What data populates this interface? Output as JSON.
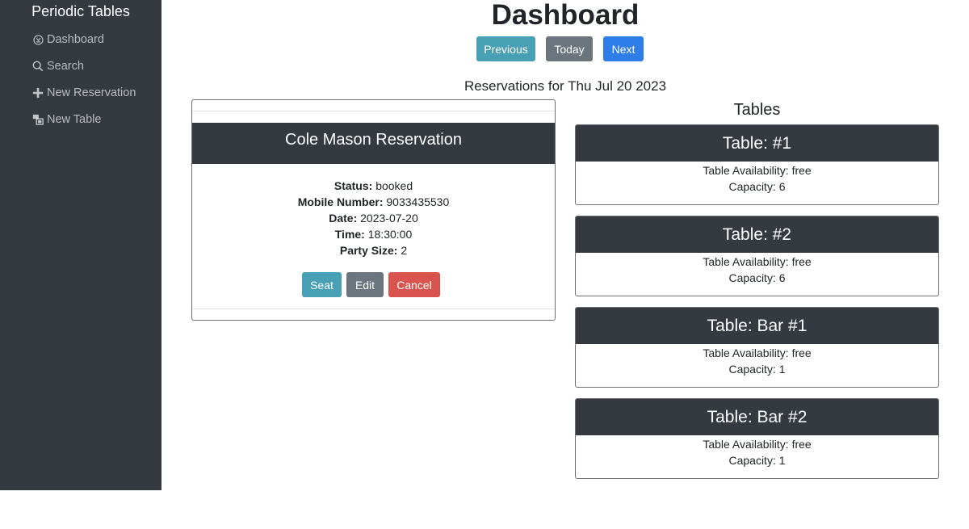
{
  "sidebar": {
    "brand": "Periodic Tables",
    "items": [
      {
        "label": "Dashboard",
        "icon": "dashboard-icon"
      },
      {
        "label": "Search",
        "icon": "search-icon"
      },
      {
        "label": "New Reservation",
        "icon": "plus-icon"
      },
      {
        "label": "New Table",
        "icon": "table-icon"
      }
    ]
  },
  "header": {
    "title": "Dashboard",
    "buttons": {
      "previous": "Previous",
      "today": "Today",
      "next": "Next"
    }
  },
  "reservations": {
    "heading": "Reservations for Thu Jul 20 2023",
    "items": [
      {
        "title": "Cole Mason Reservation",
        "status_label": "Status:",
        "status": "booked",
        "mobile_label": "Mobile Number:",
        "mobile": "9033435530",
        "date_label": "Date:",
        "date": "2023-07-20",
        "time_label": "Time:",
        "time": "18:30:00",
        "party_label": "Party Size:",
        "party_size": "2",
        "actions": {
          "seat": "Seat",
          "edit": "Edit",
          "cancel": "Cancel"
        }
      }
    ]
  },
  "tables": {
    "heading": "Tables",
    "items": [
      {
        "name": "Table: #1",
        "availability": "Table Availability: free",
        "capacity": "Capacity: 6"
      },
      {
        "name": "Table: #2",
        "availability": "Table Availability: free",
        "capacity": "Capacity: 6"
      },
      {
        "name": "Table: Bar #1",
        "availability": "Table Availability: free",
        "capacity": "Capacity: 1"
      },
      {
        "name": "Table: Bar #2",
        "availability": "Table Availability: free",
        "capacity": "Capacity: 1"
      }
    ]
  },
  "colors": {
    "sidebar_bg": "#343a40",
    "info": "#48a0b4",
    "secondary": "#6c757d",
    "primary": "#2f7de8",
    "danger": "#d9534f"
  }
}
